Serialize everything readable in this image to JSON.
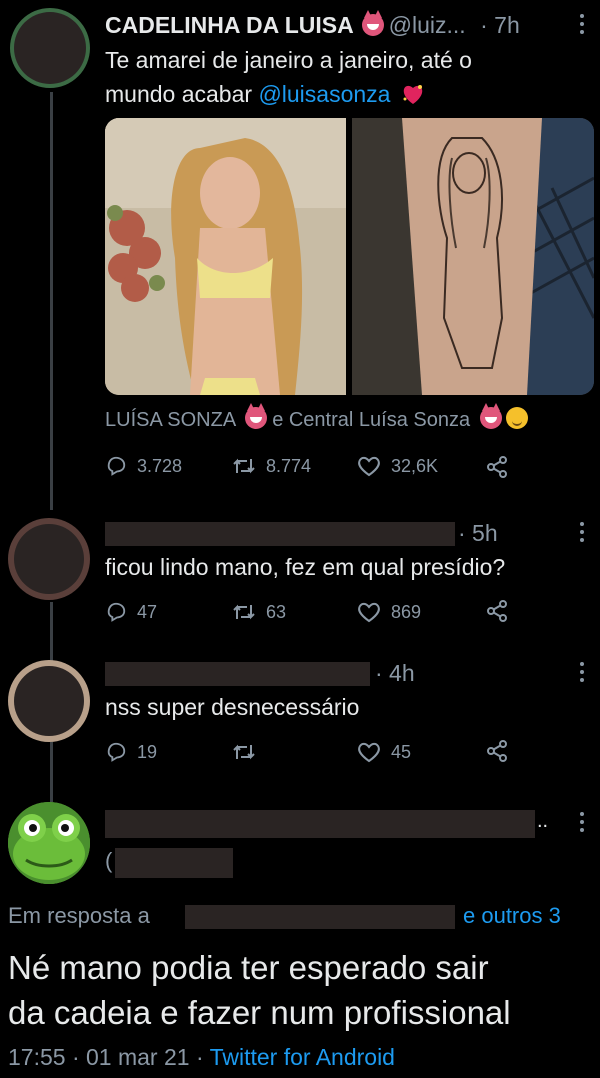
{
  "main_tweet": {
    "display_name": "CADELINHA DA LUISA",
    "handle": "@luiz...",
    "time": "· 7h",
    "text_line1": "Te amarei de janeiro a janeiro, até o",
    "text_line2_prefix": "mundo acabar ",
    "mention": "@luisasonza",
    "tagged_a": "LUÍSA SONZA",
    "tagged_sep": "e Central Luísa Sonza",
    "replies": "3.728",
    "retweets": "8.774",
    "likes": "32,6K"
  },
  "reply1": {
    "time": "· 5h",
    "text": "ficou lindo mano, fez em qual presídio?",
    "replies": "47",
    "retweets": "63",
    "likes": "869"
  },
  "reply2": {
    "time": "· 4h",
    "text": "nss super desnecessário",
    "replies": "19",
    "likes": "45"
  },
  "focused_tweet": {
    "name_suffix": "..",
    "in_reply_to": "Em resposta a",
    "and_others": "e outros 3",
    "text_line1": "Né mano podia ter esperado sair",
    "text_line2": "da cadeia e fazer num profissional",
    "timestamp": "17:55 · 01 mar 21",
    "source_sep": "·",
    "source": "Twitter for Android"
  },
  "colors": {
    "background": "#000000",
    "text": "#e7e9ea",
    "muted": "#8b98a5",
    "link": "#1d9bf0",
    "redaction": "#2a2423"
  }
}
